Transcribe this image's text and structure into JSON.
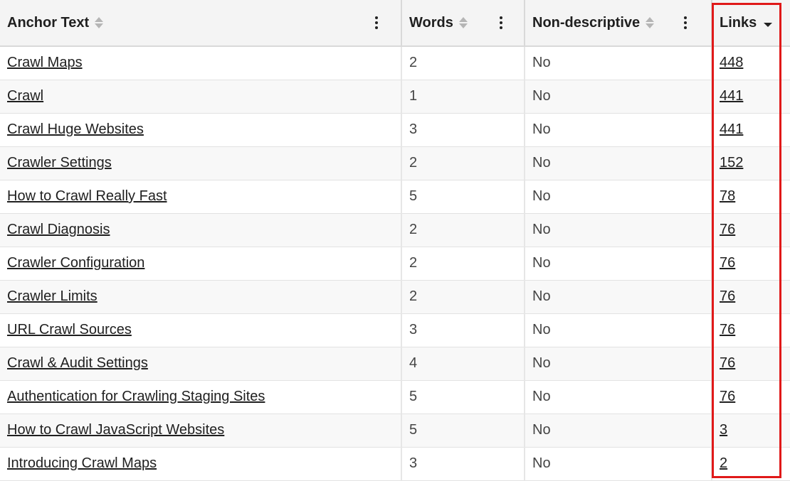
{
  "columns": {
    "anchor_text": "Anchor Text",
    "words": "Words",
    "non_descriptive": "Non-descriptive",
    "links": "Links"
  },
  "sort": {
    "column": "Links",
    "direction": "descending"
  },
  "highlight_color": "#e01919",
  "rows": [
    {
      "anchor": "Crawl Maps",
      "words": "2",
      "nondesc": "No",
      "links": "448"
    },
    {
      "anchor": "Crawl",
      "words": "1",
      "nondesc": "No",
      "links": "441"
    },
    {
      "anchor": "Crawl Huge Websites",
      "words": "3",
      "nondesc": "No",
      "links": "441"
    },
    {
      "anchor": "Crawler Settings",
      "words": "2",
      "nondesc": "No",
      "links": "152"
    },
    {
      "anchor": "How to Crawl Really Fast",
      "words": "5",
      "nondesc": "No",
      "links": "78"
    },
    {
      "anchor": "Crawl Diagnosis",
      "words": "2",
      "nondesc": "No",
      "links": "76"
    },
    {
      "anchor": "Crawler Configuration",
      "words": "2",
      "nondesc": "No",
      "links": "76"
    },
    {
      "anchor": "Crawler Limits",
      "words": "2",
      "nondesc": "No",
      "links": "76"
    },
    {
      "anchor": "URL Crawl Sources",
      "words": "3",
      "nondesc": "No",
      "links": "76"
    },
    {
      "anchor": "Crawl & Audit Settings",
      "words": "4",
      "nondesc": "No",
      "links": "76"
    },
    {
      "anchor": "Authentication for Crawling Staging Sites",
      "words": "5",
      "nondesc": "No",
      "links": "76"
    },
    {
      "anchor": "How to Crawl JavaScript Websites",
      "words": "5",
      "nondesc": "No",
      "links": "3"
    },
    {
      "anchor": "Introducing Crawl Maps",
      "words": "3",
      "nondesc": "No",
      "links": "2"
    }
  ]
}
